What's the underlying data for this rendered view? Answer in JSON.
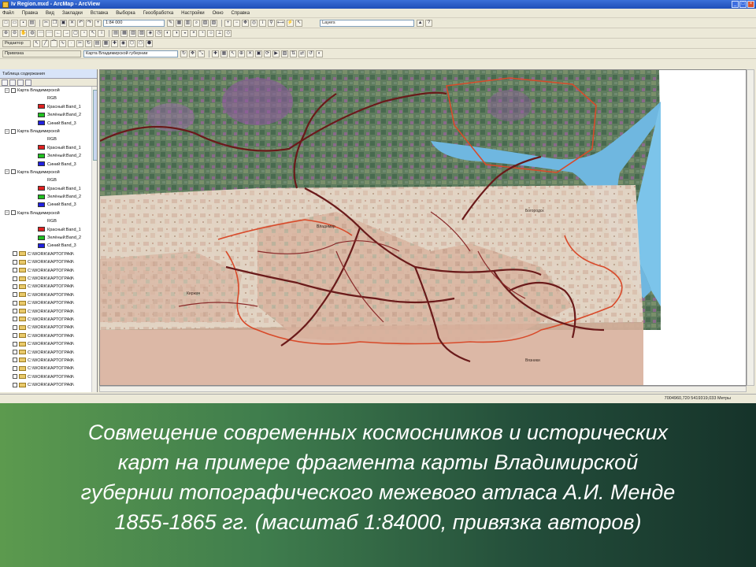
{
  "window": {
    "title": "Iv Region.mxd - ArcMap - ArcView"
  },
  "menubar": [
    "Файл",
    "Правка",
    "Вид",
    "Закладки",
    "Вставка",
    "Выборка",
    "Геообработка",
    "Настройки",
    "Окно",
    "Справка"
  ],
  "toolbar1": {
    "scale": "1:84 000",
    "layer_combo": "Layers"
  },
  "toolbar2": {
    "editor_label": "Редактор",
    "georef_label": "Привязка",
    "layer_combo": "Карта Владимирской губернии"
  },
  "toc": {
    "header": "Таблица содержания",
    "rows": [
      {
        "type": "group",
        "label": "Карта Владимирской"
      },
      {
        "type": "sub",
        "label": "RGB"
      },
      {
        "type": "band",
        "color": "#e02020",
        "label": "Красный:Band_1"
      },
      {
        "type": "band",
        "color": "#20c020",
        "label": "Зелёный:Band_2"
      },
      {
        "type": "band",
        "color": "#2020e0",
        "label": "Синий:Band_3"
      },
      {
        "type": "group",
        "label": "Карта Владимирской"
      },
      {
        "type": "sub",
        "label": "RGB"
      },
      {
        "type": "band",
        "color": "#e02020",
        "label": "Красный:Band_1"
      },
      {
        "type": "band",
        "color": "#20c020",
        "label": "Зелёный:Band_2"
      },
      {
        "type": "band",
        "color": "#2020e0",
        "label": "Синий:Band_3"
      },
      {
        "type": "group",
        "label": "Карта Владимирской"
      },
      {
        "type": "sub",
        "label": "RGB"
      },
      {
        "type": "band",
        "color": "#e02020",
        "label": "Красный:Band_1"
      },
      {
        "type": "band",
        "color": "#20c020",
        "label": "Зелёный:Band_2"
      },
      {
        "type": "band",
        "color": "#2020e0",
        "label": "Синий:Band_3"
      },
      {
        "type": "group",
        "label": "Карта Владимирской"
      },
      {
        "type": "sub",
        "label": "RGB"
      },
      {
        "type": "band",
        "color": "#e02020",
        "label": "Красный:Band_1"
      },
      {
        "type": "band",
        "color": "#20c020",
        "label": "Зелёный:Band_2"
      },
      {
        "type": "band",
        "color": "#2020e0",
        "label": "Синий:Band_3"
      },
      {
        "type": "folder",
        "label": "C:\\WORK\\КАРТОГРАФ\\"
      },
      {
        "type": "folder",
        "label": "C:\\WORK\\КАРТОГРАФ\\"
      },
      {
        "type": "folder",
        "label": "C:\\WORK\\КАРТОГРАФ\\"
      },
      {
        "type": "folder",
        "label": "C:\\WORK\\КАРТОГРАФ\\"
      },
      {
        "type": "folder",
        "label": "C:\\WORK\\КАРТОГРАФ\\"
      },
      {
        "type": "folder",
        "label": "C:\\WORK\\КАРТОГРАФ\\"
      },
      {
        "type": "folder",
        "label": "C:\\WORK\\КАРТОГРАФ\\"
      },
      {
        "type": "folder",
        "label": "C:\\WORK\\КАРТОГРАФ\\"
      },
      {
        "type": "folder",
        "label": "C:\\WORK\\КАРТОГРАФ\\"
      },
      {
        "type": "folder",
        "label": "C:\\WORK\\КАРТОГРАФ\\"
      },
      {
        "type": "folder",
        "label": "C:\\WORK\\КАРТОГРАФ\\"
      },
      {
        "type": "folder",
        "label": "C:\\WORK\\КАРТОГРАФ\\"
      },
      {
        "type": "folder",
        "label": "C:\\WORK\\КАРТОГРАФ\\"
      },
      {
        "type": "folder",
        "label": "C:\\WORK\\КАРТОГРАФ\\"
      },
      {
        "type": "folder",
        "label": "C:\\WORK\\КАРТОГРАФ\\"
      },
      {
        "type": "folder",
        "label": "C:\\WORK\\КАРТОГРАФ\\"
      },
      {
        "type": "folder",
        "label": "C:\\WORK\\КАРТОГРАФ\\"
      }
    ]
  },
  "status": {
    "coords": "7004960,720 5419319,033 Метры"
  },
  "caption": {
    "line1": "Совмещение современных космоснимков и исторических",
    "line2": "карт на примере фрагмента карты Владимирской",
    "line3": "губернии топографического межевого атласа А.И. Менде",
    "line4": "1855-1865 гг. (масштаб 1:84000, привязка авторов)"
  }
}
